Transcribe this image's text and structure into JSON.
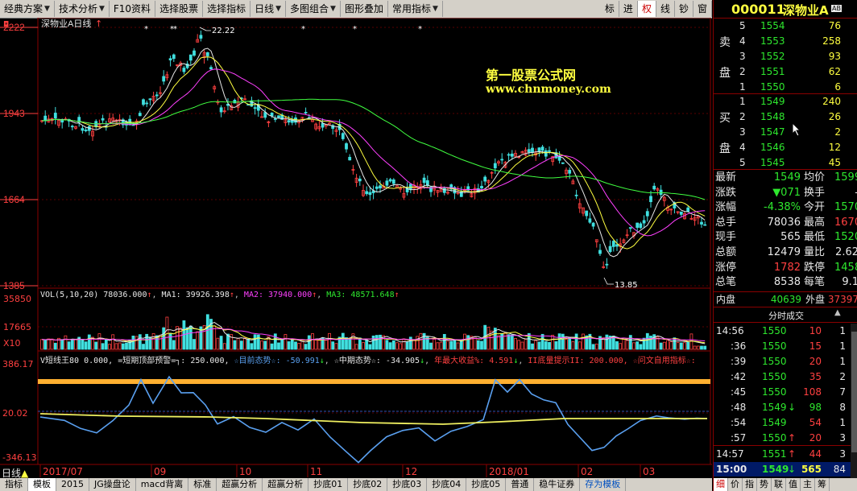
{
  "menu": {
    "items": [
      {
        "label": "经典方案",
        "arrow": true
      },
      {
        "label": "技术分析",
        "arrow": true
      },
      {
        "label": "F10资料",
        "arrow": false
      },
      {
        "label": "选择股票",
        "arrow": false
      },
      {
        "label": "选择指标",
        "arrow": false
      },
      {
        "label": "日线",
        "arrow": true
      },
      {
        "label": "多图组合",
        "arrow": true
      },
      {
        "label": "图形叠加",
        "arrow": false
      },
      {
        "label": "常用指标",
        "arrow": true
      }
    ],
    "toggles": [
      "标",
      "进",
      "权",
      "线",
      "钞",
      "窗"
    ]
  },
  "stock": {
    "code": "000011",
    "name": "深物业A",
    "badge": "AB"
  },
  "chart": {
    "caption": "深物业A日线",
    "price_ticks": [
      "2222",
      "1943",
      "1664",
      "1385"
    ],
    "high_label": "22.22",
    "low_label": "13.85",
    "watermark_line1": "第一股票公式网",
    "watermark_line2": "www.chnmoney.com",
    "vol_header": {
      "name": "VOL(5,10,20)",
      "v": "78036.000",
      "ma1": "MA1: 39926.398",
      "ma2": "MA2: 37940.000",
      "ma3": "MA3: 48571.648"
    },
    "vol_ticks": [
      "35850",
      "17665",
      "X10"
    ],
    "ind_header": {
      "name": "V短线王80 0.000, =短期顶部预警=┐: 250.000,",
      "s1": "☆目前态势☆: -50.991",
      "s2": "☆中期态势☆: -34.905",
      "s3": "年最大收益%: 4.591",
      "s4": "II底量提示II: 200.000,",
      "s5": "☆问文自用指标☆:"
    },
    "ind_ticks": [
      "386.17",
      "20.02",
      "-346.13"
    ],
    "date_labels": [
      "2017/07",
      "09",
      "10",
      "11",
      "12",
      "2018/01",
      "02",
      "03"
    ],
    "period_label": "日线"
  },
  "quote": {
    "sell_label": [
      "卖",
      "盘"
    ],
    "buy_label": [
      "买",
      "盘"
    ],
    "asks": [
      {
        "level": "5",
        "price": "1554",
        "vol": "76"
      },
      {
        "level": "4",
        "price": "1553",
        "vol": "258"
      },
      {
        "level": "3",
        "price": "1552",
        "vol": "93"
      },
      {
        "level": "2",
        "price": "1551",
        "vol": "62"
      },
      {
        "level": "1",
        "price": "1550",
        "vol": "6"
      }
    ],
    "bids": [
      {
        "level": "1",
        "price": "1549",
        "vol": "240"
      },
      {
        "level": "2",
        "price": "1548",
        "vol": "26"
      },
      {
        "level": "3",
        "price": "1547",
        "vol": "2"
      },
      {
        "level": "4",
        "price": "1546",
        "vol": "12"
      },
      {
        "level": "5",
        "price": "1545",
        "vol": "45"
      }
    ],
    "stats": [
      {
        "l1": "最新",
        "v1": "1549",
        "c1": "green",
        "l2": "均价",
        "v2": "1599",
        "c2": "green"
      },
      {
        "l1": "涨跌",
        "v1": "▼071",
        "c1": "green",
        "l2": "换手",
        "v2": "-",
        "c2": "white"
      },
      {
        "l1": "涨幅",
        "v1": "-4.38%",
        "c1": "green",
        "l2": "今开",
        "v2": "1570",
        "c2": "green"
      },
      {
        "l1": "总手",
        "v1": "78036",
        "c1": "white",
        "l2": "最高",
        "v2": "1670",
        "c2": "red"
      },
      {
        "l1": "现手",
        "v1": "565",
        "c1": "white",
        "l2": "最低",
        "v2": "1520",
        "c2": "green"
      },
      {
        "l1": "总额",
        "v1": "12479",
        "c1": "white",
        "l2": "量比",
        "v2": "2.62",
        "c2": "white"
      },
      {
        "l1": "涨停",
        "v1": "1782",
        "c1": "red",
        "l2": "跌停",
        "v2": "1458",
        "c2": "green"
      },
      {
        "l1": "总笔",
        "v1": "8538",
        "c1": "white",
        "l2": "每笔",
        "v2": "9.1",
        "c2": "white"
      }
    ],
    "inner_label": "内盘",
    "inner_value": "40639",
    "outer_label": "外盘",
    "outer_value": "37397",
    "ticks_title": "分时成交",
    "ticks": [
      {
        "time": "14:56",
        "price": "1550",
        "pc": "green",
        "arrow": "",
        "vol": "10",
        "vc": "red",
        "n": "1"
      },
      {
        "time": ":36",
        "price": "1550",
        "pc": "green",
        "arrow": "",
        "vol": "15",
        "vc": "red",
        "n": "1"
      },
      {
        "time": ":39",
        "price": "1550",
        "pc": "green",
        "arrow": "",
        "vol": "20",
        "vc": "red",
        "n": "1"
      },
      {
        "time": ":42",
        "price": "1550",
        "pc": "green",
        "arrow": "",
        "vol": "35",
        "vc": "red",
        "n": "2"
      },
      {
        "time": ":45",
        "price": "1550",
        "pc": "green",
        "arrow": "",
        "vol": "108",
        "vc": "red",
        "n": "7"
      },
      {
        "time": ":48",
        "price": "1549",
        "pc": "green",
        "arrow": "↓",
        "vol": "98",
        "vc": "green",
        "n": "8"
      },
      {
        "time": ":54",
        "price": "1549",
        "pc": "green",
        "arrow": "",
        "vol": "54",
        "vc": "red",
        "n": "1"
      },
      {
        "time": ":57",
        "price": "1550",
        "pc": "green",
        "arrow": "↑",
        "vol": "20",
        "vc": "red",
        "n": "3"
      },
      {
        "time": "14:57",
        "price": "1551",
        "pc": "green",
        "arrow": "↑",
        "vol": "44",
        "vc": "red",
        "n": "3"
      },
      {
        "time": "15:00",
        "price": "1549",
        "pc": "green",
        "arrow": "↓",
        "vol": "565",
        "vc": "yellow",
        "n": "84"
      }
    ],
    "bottom_tabs": [
      "细",
      "价",
      "指",
      "势",
      "联",
      "值",
      "主",
      "筹"
    ]
  },
  "bottombar": {
    "tabs": [
      "指标",
      "模板",
      "2015",
      "JG操盘论",
      "macd背离",
      "标准",
      "超赢分析",
      "超赢分析",
      "抄底01",
      "抄底02",
      "抄底03",
      "抄底04",
      "抄底05",
      "普通",
      "稳牛证券",
      "存为模板"
    ]
  },
  "colors": {
    "up": "#ff4040",
    "down": "#40e0e0",
    "ma5": "#e8e8e8",
    "ma10": "#ffff40",
    "ma20": "#ff40ff",
    "ma60": "#40ff40",
    "indicator_line": "#5aa0f0",
    "indicator_mid": "#f0f060",
    "indicator_top": "#ffb030"
  }
}
